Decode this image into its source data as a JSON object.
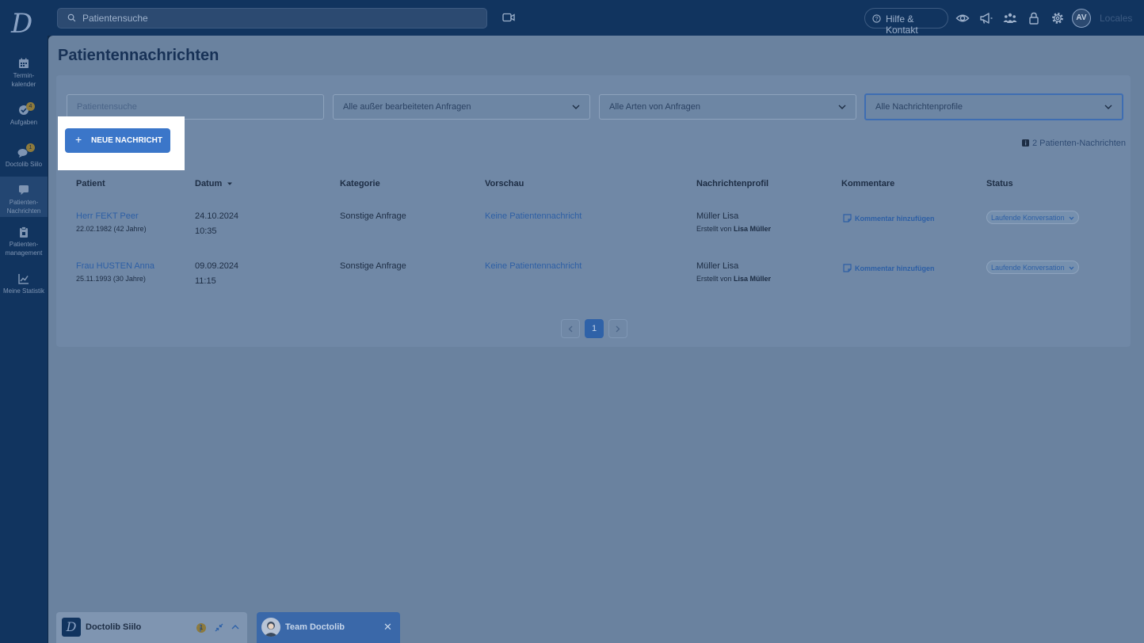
{
  "topbar": {
    "search_placeholder": "Patientensuche",
    "help_label": "Hilfe & Kontakt",
    "avatar_initials": "AV",
    "locales_label": "Locales"
  },
  "sidebar": {
    "items": [
      {
        "label_line1": "Termin-",
        "label_line2": "kalender",
        "icon": "calendar-icon"
      },
      {
        "label_line1": "Aufgaben",
        "label_line2": "",
        "icon": "tasks-icon",
        "badge": "4"
      },
      {
        "label_line1": "Doctolib Siilo",
        "label_line2": "",
        "icon": "chat-icon",
        "badge": "1"
      },
      {
        "label_line1": "Patienten-",
        "label_line2": "Nachrichten",
        "icon": "message-icon",
        "active": true
      },
      {
        "label_line1": "Patienten-",
        "label_line2": "management",
        "icon": "clipboard-icon"
      },
      {
        "label_line1": "Meine Statistik",
        "label_line2": "",
        "icon": "chart-icon"
      }
    ]
  },
  "page": {
    "title": "Patientennachrichten",
    "new_message_label": "NEUE NACHRICHT",
    "count_label": "2 Patienten-Nachrichten"
  },
  "filters": {
    "patient_search_placeholder": "Patientensuche",
    "requests_filter": "Alle außer bearbeiteten Anfragen",
    "types_filter": "Alle Arten von Anfragen",
    "profiles_filter": "Alle Nachrichtenprofile"
  },
  "table": {
    "headers": {
      "patient": "Patient",
      "date": "Datum",
      "category": "Kategorie",
      "preview": "Vorschau",
      "profile": "Nachrichtenprofil",
      "comments": "Kommentare",
      "status": "Status"
    },
    "rows": [
      {
        "patient_name": "Herr FEKT Peer",
        "birth": "22.02.1982 (42 Jahre)",
        "date": "24.10.2024",
        "time": "10:35",
        "category": "Sonstige Anfrage",
        "preview": "Keine Patientennachricht",
        "profile": "Müller Lisa",
        "created_prefix": "Erstellt von",
        "created_by": "Lisa Müller",
        "comment_action": "Kommentar hinzufügen",
        "status": "Laufende Konversation"
      },
      {
        "patient_name": "Frau HUSTEN Anna",
        "birth": "25.11.1993 (30 Jahre)",
        "date": "09.09.2024",
        "time": "11:15",
        "category": "Sonstige Anfrage",
        "preview": "Keine Patientennachricht",
        "profile": "Müller Lisa",
        "created_prefix": "Erstellt von",
        "created_by": "Lisa Müller",
        "comment_action": "Kommentar hinzufügen",
        "status": "Laufende Konversation"
      }
    ]
  },
  "pagination": {
    "current_page": "1",
    "prev_icon": "chevron-left-icon",
    "next_icon": "chevron-right-icon"
  },
  "dock": {
    "siilo_label": "Doctolib Siilo",
    "siilo_badge": "1",
    "team_label": "Team Doctolib"
  }
}
